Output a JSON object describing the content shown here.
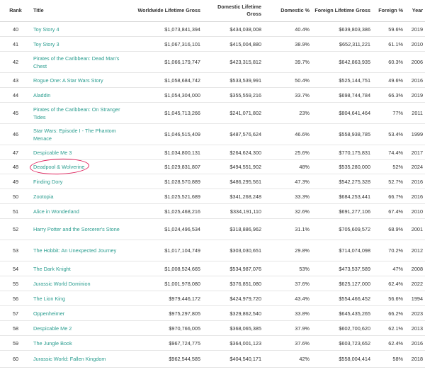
{
  "headers": {
    "rank": "Rank",
    "title": "Title",
    "worldwide": "Worldwide Lifetime Gross",
    "domestic": "Domestic Lifetime Gross",
    "domestic_pct": "Domestic %",
    "foreign": "Foreign Lifetime Gross",
    "foreign_pct": "Foreign %",
    "year": "Year"
  },
  "rows": [
    {
      "rank": "40",
      "title": "Toy Story 4",
      "worldwide": "$1,073,841,394",
      "domestic": "$434,038,008",
      "domestic_pct": "40.4%",
      "foreign": "$639,803,386",
      "foreign_pct": "59.6%",
      "year": "2019"
    },
    {
      "rank": "41",
      "title": "Toy Story 3",
      "worldwide": "$1,067,316,101",
      "domestic": "$415,004,880",
      "domestic_pct": "38.9%",
      "foreign": "$652,311,221",
      "foreign_pct": "61.1%",
      "year": "2010"
    },
    {
      "rank": "42",
      "title": "Pirates of the Caribbean: Dead Man's Chest",
      "worldwide": "$1,066,179,747",
      "domestic": "$423,315,812",
      "domestic_pct": "39.7%",
      "foreign": "$642,863,935",
      "foreign_pct": "60.3%",
      "year": "2006"
    },
    {
      "rank": "43",
      "title": "Rogue One: A Star Wars Story",
      "worldwide": "$1,058,684,742",
      "domestic": "$533,539,991",
      "domestic_pct": "50.4%",
      "foreign": "$525,144,751",
      "foreign_pct": "49.6%",
      "year": "2016"
    },
    {
      "rank": "44",
      "title": "Aladdin",
      "worldwide": "$1,054,304,000",
      "domestic": "$355,559,216",
      "domestic_pct": "33.7%",
      "foreign": "$698,744,784",
      "foreign_pct": "66.3%",
      "year": "2019"
    },
    {
      "rank": "45",
      "title": "Pirates of the Caribbean: On Stranger Tides",
      "worldwide": "$1,045,713,266",
      "domestic": "$241,071,802",
      "domestic_pct": "23%",
      "foreign": "$804,641,464",
      "foreign_pct": "77%",
      "year": "2011"
    },
    {
      "rank": "46",
      "title": "Star Wars: Episode I - The Phantom Menace",
      "worldwide": "$1,046,515,409",
      "domestic": "$487,576,624",
      "domestic_pct": "46.6%",
      "foreign": "$558,938,785",
      "foreign_pct": "53.4%",
      "year": "1999"
    },
    {
      "rank": "47",
      "title": "Despicable Me 3",
      "worldwide": "$1,034,800,131",
      "domestic": "$264,624,300",
      "domestic_pct": "25.6%",
      "foreign": "$770,175,831",
      "foreign_pct": "74.4%",
      "year": "2017"
    },
    {
      "rank": "48",
      "title": "Deadpool & Wolverine",
      "worldwide": "$1,029,831,807",
      "domestic": "$494,551,902",
      "domestic_pct": "48%",
      "foreign": "$535,280,000",
      "foreign_pct": "52%",
      "year": "2024"
    },
    {
      "rank": "49",
      "title": "Finding Dory",
      "worldwide": "$1,028,570,889",
      "domestic": "$486,295,561",
      "domestic_pct": "47.3%",
      "foreign": "$542,275,328",
      "foreign_pct": "52.7%",
      "year": "2016"
    },
    {
      "rank": "50",
      "title": "Zootopia",
      "worldwide": "$1,025,521,689",
      "domestic": "$341,268,248",
      "domestic_pct": "33.3%",
      "foreign": "$684,253,441",
      "foreign_pct": "66.7%",
      "year": "2016"
    },
    {
      "rank": "51",
      "title": "Alice in Wonderland",
      "worldwide": "$1,025,468,216",
      "domestic": "$334,191,110",
      "domestic_pct": "32.6%",
      "foreign": "$691,277,106",
      "foreign_pct": "67.4%",
      "year": "2010"
    },
    {
      "rank": "52",
      "title": "Harry Potter and the Sorcerer's Stone",
      "worldwide": "$1,024,496,534",
      "domestic": "$318,886,962",
      "domestic_pct": "31.1%",
      "foreign": "$705,609,572",
      "foreign_pct": "68.9%",
      "year": "2001"
    },
    {
      "rank": "53",
      "title": "The Hobbit: An Unexpected Journey",
      "worldwide": "$1,017,104,749",
      "domestic": "$303,030,651",
      "domestic_pct": "29.8%",
      "foreign": "$714,074,098",
      "foreign_pct": "70.2%",
      "year": "2012"
    },
    {
      "rank": "54",
      "title": "The Dark Knight",
      "worldwide": "$1,008,524,665",
      "domestic": "$534,987,076",
      "domestic_pct": "53%",
      "foreign": "$473,537,589",
      "foreign_pct": "47%",
      "year": "2008"
    },
    {
      "rank": "55",
      "title": "Jurassic World Dominion",
      "worldwide": "$1,001,978,080",
      "domestic": "$376,851,080",
      "domestic_pct": "37.6%",
      "foreign": "$625,127,000",
      "foreign_pct": "62.4%",
      "year": "2022"
    },
    {
      "rank": "56",
      "title": "The Lion King",
      "worldwide": "$979,446,172",
      "domestic": "$424,979,720",
      "domestic_pct": "43.4%",
      "foreign": "$554,466,452",
      "foreign_pct": "56.6%",
      "year": "1994"
    },
    {
      "rank": "57",
      "title": "Oppenheimer",
      "worldwide": "$975,297,805",
      "domestic": "$329,862,540",
      "domestic_pct": "33.8%",
      "foreign": "$645,435,265",
      "foreign_pct": "66.2%",
      "year": "2023"
    },
    {
      "rank": "58",
      "title": "Despicable Me 2",
      "worldwide": "$970,766,005",
      "domestic": "$368,065,385",
      "domestic_pct": "37.9%",
      "foreign": "$602,700,620",
      "foreign_pct": "62.1%",
      "year": "2013"
    },
    {
      "rank": "59",
      "title": "The Jungle Book",
      "worldwide": "$967,724,775",
      "domestic": "$364,001,123",
      "domestic_pct": "37.6%",
      "foreign": "$603,723,652",
      "foreign_pct": "62.4%",
      "year": "2016"
    },
    {
      "rank": "60",
      "title": "Jurassic World: Fallen Kingdom",
      "worldwide": "$962,544,585",
      "domestic": "$404,540,171",
      "domestic_pct": "42%",
      "foreign": "$558,004,414",
      "foreign_pct": "58%",
      "year": "2018"
    }
  ],
  "colors": {
    "link": "#2a9d8f",
    "highlight_circle": "#e0245e"
  }
}
